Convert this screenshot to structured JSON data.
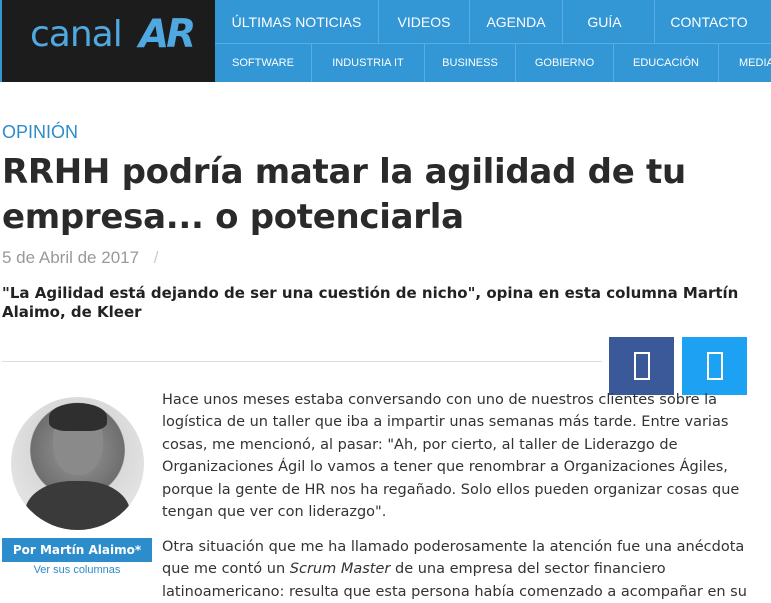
{
  "logo": {
    "part1": "canal",
    "part2": "AR"
  },
  "nav_top": [
    {
      "label": "ÚLTIMAS NOTICIAS",
      "icon": ""
    },
    {
      "label": "VIDEOS",
      "icon": ""
    },
    {
      "label": "AGENDA",
      "icon": ""
    },
    {
      "label": "GUÍA",
      "icon": ""
    },
    {
      "label": "CONTACTO",
      "icon": ""
    }
  ],
  "nav_sub": [
    "SOFTWARE",
    "INDUSTRIA IT",
    "BUSINESS",
    "GOBIERNO",
    "EDUCACIÓN",
    "MEDIA"
  ],
  "article": {
    "category": "OPINIÓN",
    "title_line1": "RRHH podría matar la agilidad de tu",
    "title_line2": "empresa... o potenciarla",
    "date": "5 de Abril de 2017",
    "date_sep": "/",
    "subtitle": "\"La Agilidad está dejando de ser una cuestión de nicho\", opina en esta columna Martín Alaimo, de Kleer",
    "para1": "Hace unos meses estaba conversando con uno de nuestros clientes sobre la logística de un taller que iba a impartir unas semanas más tarde. Entre varias cosas, me mencionó, al pasar: \"Ah, por cierto, al taller de Liderazgo de Organizaciones Ágil lo vamos a tener que renombrar a Organizaciones Ágiles, porque la gente de HR nos ha regañado. Solo ellos pueden organizar cosas que tengan que ver con liderazgo\".",
    "para2_a": "Otra situación que me ha llamado poderosamente la atención fue una anécdota que me contó un ",
    "para2_em": "Scrum Master",
    "para2_b": " de una empresa del sector financiero latinoamericano: resulta que esta persona había comenzado a acompañar en su"
  },
  "author": {
    "button": "Por Martín Alaimo*",
    "link": "Ver sus columnas"
  },
  "share": {
    "facebook_icon": "facebook-icon",
    "twitter_icon": "twitter-icon"
  },
  "colors": {
    "nav_blue": "#3397d6",
    "accent": "#2d8ccb",
    "facebook": "#3b5998",
    "twitter": "#1da1f2"
  }
}
